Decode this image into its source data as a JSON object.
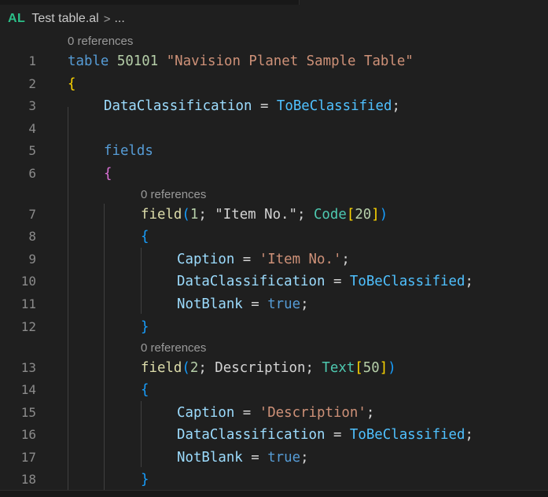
{
  "tab_strip": {},
  "breadcrumb": {
    "lang": "AL",
    "file": "Test table.al",
    "separator": ">",
    "more": "..."
  },
  "code_lens": {
    "table_refs": "0 references",
    "field1_refs": "0 references",
    "field2_refs": "0 references"
  },
  "lines": [
    {
      "n": "1"
    },
    {
      "n": "2"
    },
    {
      "n": "3"
    },
    {
      "n": "4"
    },
    {
      "n": "5"
    },
    {
      "n": "6"
    },
    {
      "n": "7"
    },
    {
      "n": "8"
    },
    {
      "n": "9"
    },
    {
      "n": "10"
    },
    {
      "n": "11"
    },
    {
      "n": "12"
    },
    {
      "n": "13"
    },
    {
      "n": "14"
    },
    {
      "n": "15"
    },
    {
      "n": "16"
    },
    {
      "n": "17"
    },
    {
      "n": "18"
    }
  ],
  "code": {
    "table_kw": "table",
    "table_id": "50101",
    "table_name": "\"Navision Planet Sample Table\"",
    "open_brace": "{",
    "close_brace": "}",
    "dataclass_prop": "DataClassification",
    "equals": " = ",
    "tobeclassified": "ToBeClassified",
    "semicolon": ";",
    "fields_kw": "fields",
    "field_kw": "field",
    "paren_open": "(",
    "paren_close": ")",
    "field1_no": "1",
    "sep": "; ",
    "field1_name": "\"Item No.\"",
    "code_type": "Code",
    "bracket_open": "[",
    "bracket_close": "]",
    "field1_len": "20",
    "caption_prop": "Caption",
    "field1_caption": "'Item No.'",
    "notblank_prop": "NotBlank",
    "true_val": "true",
    "field2_no": "2",
    "field2_name": "Description",
    "text_type": "Text",
    "field2_len": "50",
    "field2_caption": "'Description'"
  }
}
